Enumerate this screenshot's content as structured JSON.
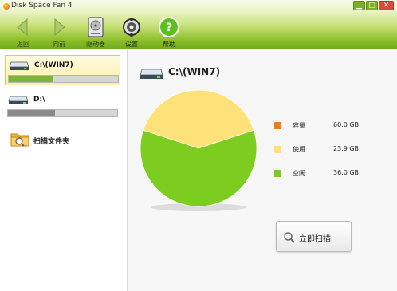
{
  "window": {
    "title": "Disk Space Fan 4",
    "controls": {
      "minimize": "▁",
      "maximize": "□",
      "close": "✕"
    }
  },
  "toolbar": {
    "back": {
      "label": "返回",
      "icon": "arrow-left-icon",
      "enabled": false
    },
    "forward": {
      "label": "向前",
      "icon": "arrow-right-icon",
      "enabled": false
    },
    "drives": {
      "label": "驱动器",
      "icon": "hard-drive-icon"
    },
    "settings": {
      "label": "设置",
      "icon": "gear-icon"
    },
    "help": {
      "label": "帮助",
      "icon": "help-icon"
    }
  },
  "sidebar": {
    "drives": [
      {
        "label": "C:\\(WIN7)",
        "used_fraction": 0.4,
        "bar_color": "#7cb342",
        "selected": true
      },
      {
        "label": "D:\\",
        "used_fraction": 0.43,
        "bar_color": "#8a8a8a",
        "selected": false
      }
    ],
    "scan_folder_label": "扫描文件夹"
  },
  "main": {
    "drive_title": "C:\\(WIN7)",
    "legend": [
      {
        "name": "容量",
        "value": "60.0 GB",
        "color": "#f07d1a"
      },
      {
        "name": "使用",
        "value": "23.9 GB",
        "color": "#fde27a"
      },
      {
        "name": "空闲",
        "value": "36.0 GB",
        "color": "#7ccd1f"
      }
    ],
    "scan_button_label": "立即扫描"
  },
  "chart_data": {
    "type": "pie",
    "categories": [
      "使用",
      "空闲"
    ],
    "values": [
      23.9,
      36.0
    ],
    "colors": [
      "#fde27a",
      "#7ccd1f"
    ]
  }
}
